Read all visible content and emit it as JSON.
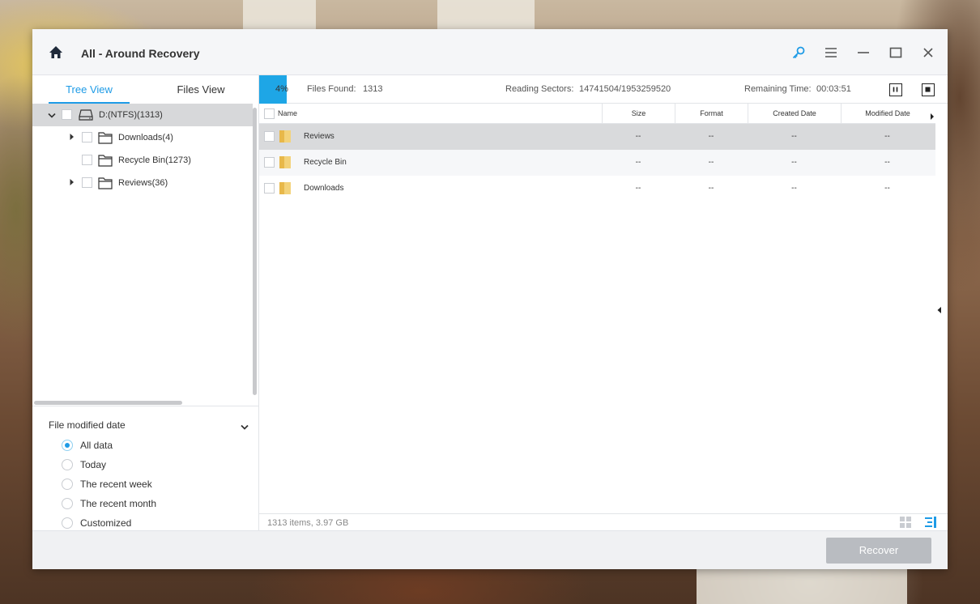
{
  "window": {
    "title": "All - Around Recovery"
  },
  "tabs": [
    {
      "label": "Tree View",
      "active": true
    },
    {
      "label": "Files View",
      "active": false
    }
  ],
  "tree": [
    {
      "label": "D:(NTFS)(1313)",
      "icon": "drive-icon",
      "expanded": true,
      "selected": true
    },
    {
      "label": "Downloads(4)",
      "icon": "folder-outline-icon",
      "expandable": true
    },
    {
      "label": "Recycle Bin(1273)",
      "icon": "folder-outline-icon",
      "expandable": false
    },
    {
      "label": "Reviews(36)",
      "icon": "folder-outline-icon",
      "expandable": true
    }
  ],
  "filter": {
    "title": "File modified date",
    "options": [
      {
        "label": "All data",
        "checked": true
      },
      {
        "label": "Today",
        "checked": false
      },
      {
        "label": "The recent week",
        "checked": false
      },
      {
        "label": "The recent month",
        "checked": false
      },
      {
        "label": "Customized",
        "checked": false
      }
    ]
  },
  "status": {
    "progress_label": "4%",
    "progress_value": 0.04,
    "files_found_label": "Files Found:",
    "files_found": "1313",
    "reading_sectors_label": "Reading Sectors:",
    "reading_sectors": "14741504/1953259520",
    "remaining_label": "Remaining Time:",
    "remaining": "00:03:51"
  },
  "table": {
    "columns": [
      "Name",
      "Size",
      "Format",
      "Created Date",
      "Modified Date"
    ],
    "rows": [
      {
        "name": "Reviews",
        "size": "--",
        "format": "--",
        "created": "--",
        "modified": "--",
        "selected": true
      },
      {
        "name": "Recycle Bin",
        "size": "--",
        "format": "--",
        "created": "--",
        "modified": "--"
      },
      {
        "name": "Downloads",
        "size": "--",
        "format": "--",
        "created": "--",
        "modified": "--"
      }
    ]
  },
  "footer": {
    "summary": "1313 items, 3.97 GB"
  },
  "actions": {
    "recover_label": "Recover"
  },
  "colors": {
    "accent": "#1e9be6",
    "progress": "#1ea6e6",
    "selection": "#d7d8da",
    "recover_disabled": "#b9bcc1"
  }
}
